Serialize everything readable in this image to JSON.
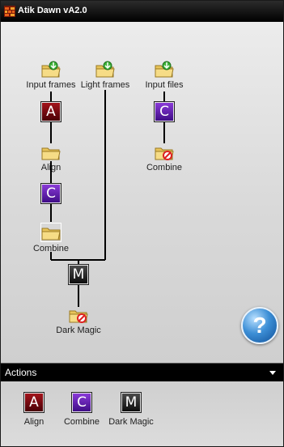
{
  "window": {
    "title": "Atik Dawn vA2.0"
  },
  "flow": {
    "sources": [
      {
        "label": "Input frames",
        "icon": "folder-green-arrow-icon"
      },
      {
        "label": "Light frames",
        "icon": "folder-green-arrow-icon"
      },
      {
        "label": "Input files",
        "icon": "folder-green-arrow-icon"
      }
    ],
    "steps": {
      "a1": {
        "letter": "A",
        "kind": "align"
      },
      "align": {
        "label": "Align",
        "icon": "folder-icon"
      },
      "c1": {
        "letter": "C",
        "kind": "combine"
      },
      "combine1": {
        "label": "Combine",
        "icon": "folder-selected-icon"
      },
      "c2": {
        "letter": "C",
        "kind": "combine"
      },
      "combine2": {
        "label": "Combine",
        "icon": "folder-disabled-icon"
      },
      "m1": {
        "letter": "M",
        "kind": "dark-magic"
      },
      "darkmagic": {
        "label": "Dark Magic",
        "icon": "folder-disabled-icon"
      }
    }
  },
  "help": {
    "label": "?"
  },
  "actions": {
    "title": "Actions",
    "items": [
      {
        "letter": "A",
        "label": "Align"
      },
      {
        "letter": "C",
        "label": "Combine"
      },
      {
        "letter": "M",
        "label": "Dark Magic"
      }
    ]
  }
}
